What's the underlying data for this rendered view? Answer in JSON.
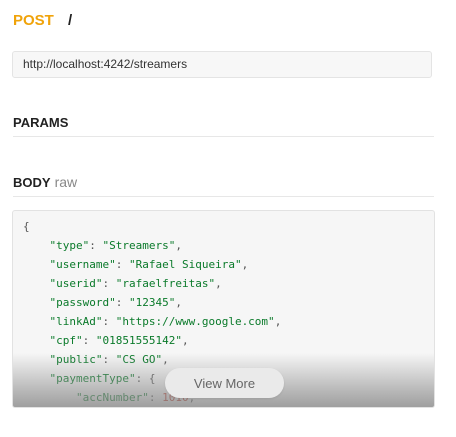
{
  "request": {
    "method": "POST",
    "path": "/",
    "url": "http://localhost:4242/streamers"
  },
  "sections": {
    "params_label": "PARAMS",
    "body_label": "BODY",
    "body_type": "raw"
  },
  "body_code": {
    "lines": [
      "{",
      "    \"type\": \"Streamers\",",
      "    \"username\": \"Rafael Siqueira\",",
      "    \"userid\": \"rafaelfreitas\",",
      "    \"password\": \"12345\",",
      "    \"linkAd\": \"https://www.google.com\",",
      "    \"cpf\": \"01851555142\",",
      "    \"public\": \"CS GO\",",
      "    \"paymentType\": {",
      "        \"accNumber\": 1010,"
    ]
  },
  "view_more_label": "View More",
  "colors": {
    "method": "#f0a30a",
    "code_string": "#0a7a2a",
    "code_number": "#c0392b"
  }
}
